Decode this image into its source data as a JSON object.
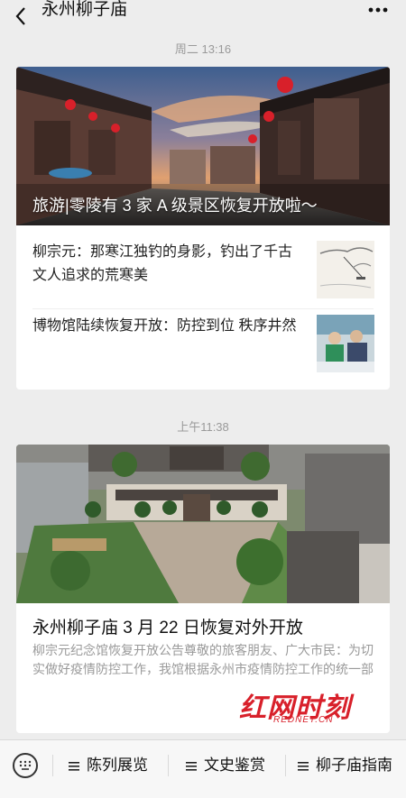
{
  "header": {
    "title": "永州柳子庙"
  },
  "timestamps": [
    "周二 13:16",
    "上午11:38"
  ],
  "article_group_1": {
    "headline": "旅游|零陵有 3 家 A 级景区恢复开放啦～",
    "items": [
      {
        "title": "柳宗元：那寒江独钓的身影，钓出了千古文人追求的荒寒美"
      },
      {
        "title": "博物馆陆续恢复开放：防控到位 秩序井然"
      }
    ]
  },
  "article_group_2": {
    "headline": "永州柳子庙 3 月 22 日恢复对外开放",
    "summary": "柳宗元纪念馆恢复开放公告尊敬的旅客朋友、广大市民：为切实做好疫情防控工作，我馆根据永州市疫情防控工作的统一部"
  },
  "watermark": {
    "main": "红网时刻",
    "sub": "REDNET.CN"
  },
  "bottom_menu": {
    "items": [
      {
        "label": "陈列展览"
      },
      {
        "label": "文史鉴赏"
      },
      {
        "label": "柳子庙指南"
      }
    ]
  },
  "colors": {
    "background": "#ededed",
    "card": "#ffffff",
    "timestamp": "#9a9a9a",
    "watermark": "#d8202a"
  }
}
